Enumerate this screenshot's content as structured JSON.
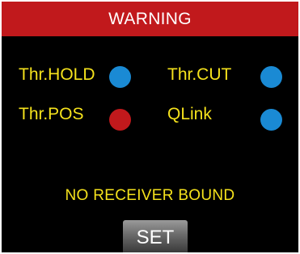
{
  "header": {
    "title": "WARNING"
  },
  "status_items": [
    {
      "label": "Thr.HOLD",
      "indicator_color": "#1a8ad4",
      "indicator_icon": "status-dot-icon"
    },
    {
      "label": "Thr.CUT",
      "indicator_color": "#1a8ad4",
      "indicator_icon": "status-dot-icon"
    },
    {
      "label": "Thr.POS",
      "indicator_color": "#c1191c",
      "indicator_icon": "status-dot-icon"
    },
    {
      "label": "QLink",
      "indicator_color": "#1a8ad4",
      "indicator_icon": "status-dot-icon"
    }
  ],
  "message": "NO RECEIVER BOUND",
  "set_button": {
    "label": "SET"
  },
  "colors": {
    "title_bar": "#c1191c",
    "label_text": "#f5e21c",
    "ok_indicator": "#1a8ad4",
    "warning_indicator": "#c1191c",
    "background": "#000000"
  }
}
